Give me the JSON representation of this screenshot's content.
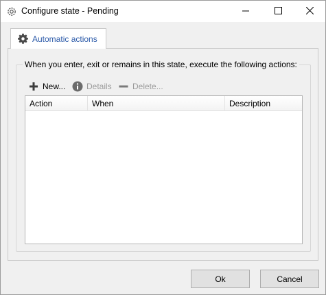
{
  "window": {
    "title": "Configure state - Pending",
    "icons": {
      "title": "gear-outline-icon",
      "minimize": "minimize-icon",
      "maximize": "maximize-icon",
      "close": "close-icon"
    }
  },
  "tabs": [
    {
      "label": "Automatic actions",
      "icon": "gear-icon",
      "selected": true
    }
  ],
  "group": {
    "caption": "When you enter, exit or remains in this state, execute the following actions:"
  },
  "toolbar": {
    "new_label": "New...",
    "details_label": "Details",
    "delete_label": "Delete...",
    "details_enabled": false,
    "delete_enabled": false
  },
  "actions_table": {
    "columns": [
      "Action",
      "When",
      "Description"
    ],
    "rows": []
  },
  "buttons": {
    "ok_label": "Ok",
    "cancel_label": "Cancel"
  },
  "colors": {
    "tab_label": "#2e5caa",
    "disabled_text": "#9a9a9a",
    "dialog_background": "#f0f0f0"
  }
}
